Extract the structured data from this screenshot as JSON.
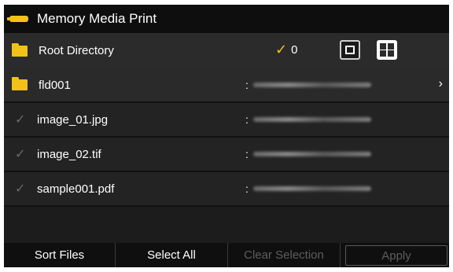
{
  "app": {
    "title": "Memory Media Print"
  },
  "path": {
    "label": "Root Directory",
    "selected_count": "0"
  },
  "view_modes": [
    {
      "name": "single",
      "active": false
    },
    {
      "name": "thumbnail",
      "active": false
    },
    {
      "name": "list",
      "active": true
    }
  ],
  "items": [
    {
      "type": "folder",
      "name": "fld001",
      "date_prefix": ":",
      "date_blurred": true
    },
    {
      "type": "file",
      "name": "image_01.jpg",
      "date_prefix": ":",
      "date_blurred": true
    },
    {
      "type": "file",
      "name": "image_02.tif",
      "date_prefix": ":",
      "date_blurred": true
    },
    {
      "type": "file",
      "name": "sample001.pdf",
      "date_prefix": ":",
      "date_blurred": true
    }
  ],
  "actions": {
    "sort": "Sort Files",
    "select_all": "Select All",
    "clear": "Clear Selection",
    "apply": "Apply"
  },
  "colors": {
    "accent": "#f2c21b",
    "background": "#1c1c1c",
    "disabled": "#5d5d5d"
  },
  "icons": [
    "battery-icon",
    "folder-icon",
    "checkmark-icon",
    "single-view-icon",
    "thumbnail-view-icon",
    "list-view-icon",
    "chevron-right-icon"
  ]
}
